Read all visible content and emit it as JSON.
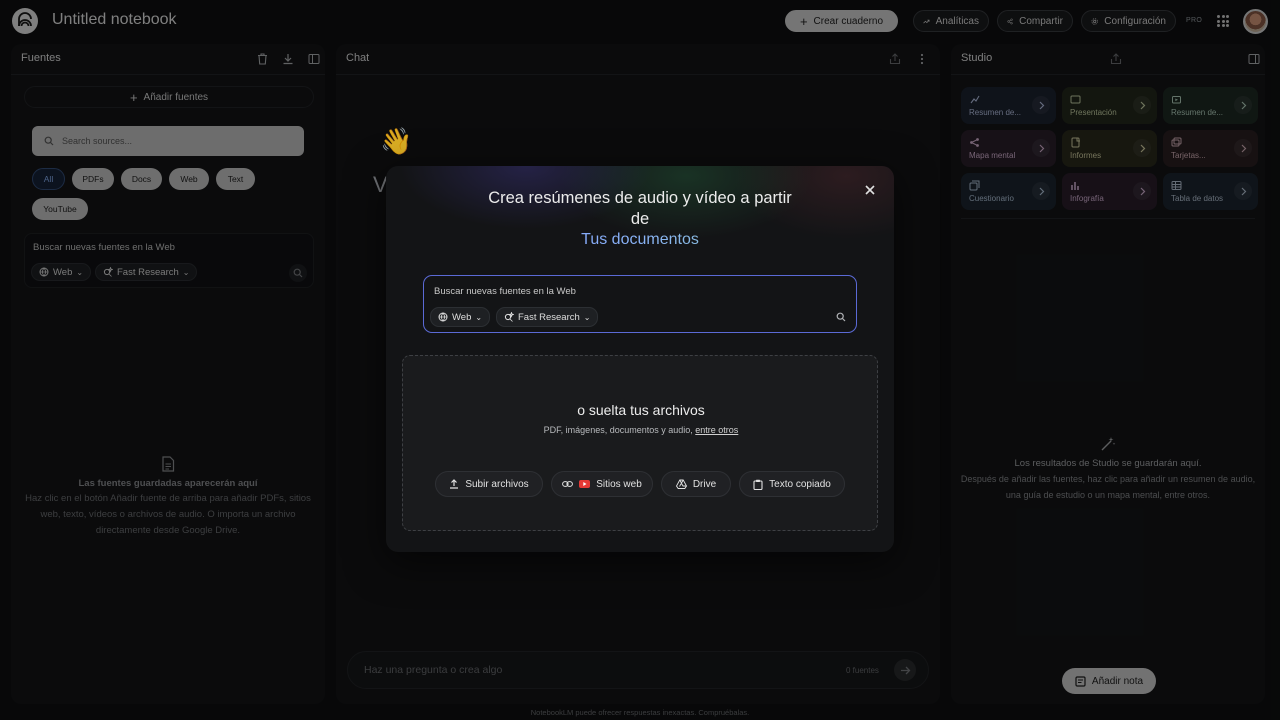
{
  "app": {
    "title": "Untitled notebook"
  },
  "topbar": {
    "create_label": "Crear cuaderno",
    "analytics_label": "Analíticas",
    "share_label": "Compartir",
    "settings_label": "Configuración",
    "plan_badge": "PRO"
  },
  "sources": {
    "title": "Fuentes",
    "add_label": "Añadir fuentes",
    "search_placeholder": "Search sources...",
    "filters": [
      "All",
      "PDFs",
      "Docs",
      "Web",
      "Text",
      "YouTube"
    ],
    "web_search_placeholder": "Buscar nuevas fuentes en la Web",
    "web_label": "Web",
    "research_label": "Fast Research",
    "empty_title": "Las fuentes guardadas aparecerán aquí",
    "empty_text": "Haz clic en el botón Añadir fuente de arriba para añadir PDFs, sitios web, texto, vídeos o archivos de audio. O importa un archivo directamente desde Google Drive."
  },
  "chat": {
    "title": "Chat",
    "input_placeholder": "Haz una pregunta o crea algo",
    "source_count": "0 fuentes",
    "footer": "NotebookLM puede ofrecer respuestas inexactas. Compruébalas."
  },
  "studio": {
    "title": "Studio",
    "tiles": [
      {
        "label": "Resumen de...",
        "icon": "sparkle-wave-icon",
        "bg": "#1c2330",
        "fg": "#b8c4e6"
      },
      {
        "label": "Presentación",
        "icon": "slides-icon",
        "bg": "#24291c",
        "fg": "#c9d4a8"
      },
      {
        "label": "Resumen de...",
        "icon": "video-icon",
        "bg": "#1e2a24",
        "fg": "#b6d4c2"
      },
      {
        "label": "Mapa mental",
        "icon": "mindmap-icon",
        "bg": "#2a1f2b",
        "fg": "#d9b6d6"
      },
      {
        "label": "Informes",
        "icon": "report-icon",
        "bg": "#2a2a1c",
        "fg": "#d9d6a8"
      },
      {
        "label": "Tarjetas...",
        "icon": "flashcards-icon",
        "bg": "#2b1f22",
        "fg": "#d9b6bd"
      },
      {
        "label": "Cuestionario",
        "icon": "quiz-icon",
        "bg": "#1c2630",
        "fg": "#b4c8de"
      },
      {
        "label": "Infografía",
        "icon": "infographic-icon",
        "bg": "#2a1e2b",
        "fg": "#d6b4d8"
      },
      {
        "label": "Tabla de datos",
        "icon": "table-icon",
        "bg": "#1c2630",
        "fg": "#b8c6d8"
      }
    ],
    "empty_title": "Los resultados de Studio se guardarán aquí.",
    "empty_text": "Después de añadir las fuentes, haz clic para añadir un resumen de audio, una guía de estudio o un mapa mental, entre otros.",
    "add_note_label": "Añadir nota"
  },
  "modal": {
    "title_line1": "Crea resúmenes de audio y vídeo a partir",
    "title_line2": "de",
    "subtitle": "Tus documentos",
    "search_placeholder": "Buscar nuevas fuentes en la Web",
    "web_label": "Web",
    "research_label": "Fast Research",
    "drop_title": "o suelta tus archivos",
    "drop_sub": "PDF, imágenes, documentos y audio,",
    "drop_sub_link": "entre otros",
    "buttons": {
      "upload": "Subir archivos",
      "websites": "Sitios web",
      "drive": "Drive",
      "pasted": "Texto copiado"
    }
  }
}
